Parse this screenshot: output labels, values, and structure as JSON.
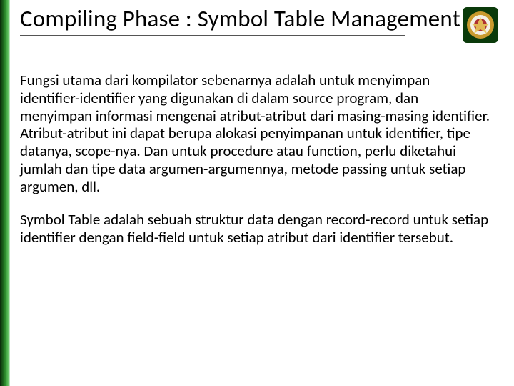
{
  "slide": {
    "title": "Compiling Phase : Symbol Table Management",
    "paragraph1": "Fungsi utama dari kompilator sebenarnya adalah untuk menyimpan identifier-identifier yang digunakan di dalam source program, dan menyimpan informasi mengenai atribut-atribut dari masing-masing identifier. Atribut-atribut ini dapat berupa alokasi penyimpanan untuk identifier, tipe datanya, scope-nya. Dan untuk procedure atau function, perlu diketahui jumlah dan tipe data argumen-argumennya, metode passing untuk setiap argumen, dll.",
    "paragraph2": "Symbol Table adalah sebuah struktur data dengan record-record untuk setiap identifier dengan field-field untuk setiap atribut dari identifier tersebut."
  }
}
